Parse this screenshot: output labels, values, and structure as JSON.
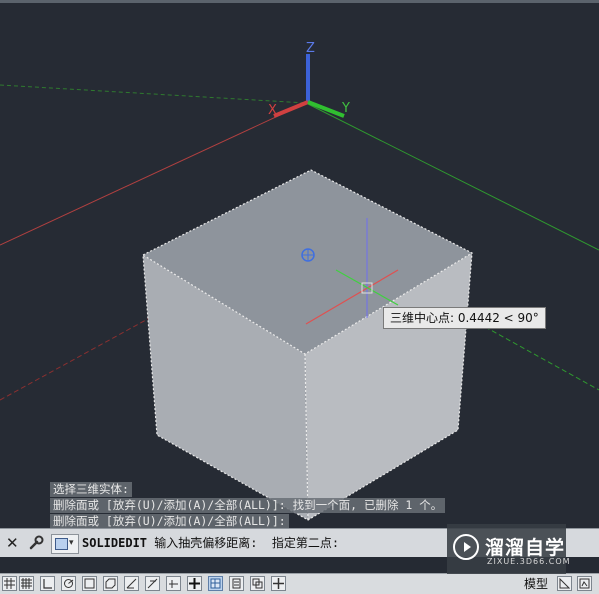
{
  "viewport": {
    "axis_labels": {
      "x": "X",
      "y": "Y",
      "z": "Z"
    },
    "tooltip": "三维中心点: 0.4442 < 90°"
  },
  "command_history": [
    "选择三维实体:",
    "删除面或 [放弃(U)/添加(A)/全部(ALL)]: 找到一个面, 已删除 1 个。",
    "删除面或 [放弃(U)/添加(A)/全部(ALL)]:"
  ],
  "command_line": {
    "close_glyph": "✕",
    "command": "SOLIDEDIT",
    "prompt": " 输入抽壳偏移距离:  指定第二点:"
  },
  "status_bar": {
    "model_label": "模型",
    "buttons": [
      {
        "icon": "grid-icon",
        "on": false
      },
      {
        "icon": "ortho-icon",
        "on": false
      },
      {
        "icon": "polar-icon",
        "on": false
      },
      {
        "icon": "osnap-icon",
        "on": false
      },
      {
        "icon": "3d-osnap-icon",
        "on": false
      },
      {
        "icon": "otrack-icon",
        "on": false
      },
      {
        "icon": "ducs-icon",
        "on": false
      },
      {
        "icon": "dyn-icon",
        "on": false
      },
      {
        "icon": "lineweight-icon",
        "on": false
      },
      {
        "icon": "transparency-icon",
        "on": true
      },
      {
        "icon": "quick-properties-icon",
        "on": false
      },
      {
        "icon": "selection-cycling-icon",
        "on": false
      },
      {
        "icon": "annotation-monitor-icon",
        "on": false
      }
    ]
  },
  "watermark": {
    "main": "溜溜自学",
    "sub": "ZIXUE.3D66.COM"
  }
}
